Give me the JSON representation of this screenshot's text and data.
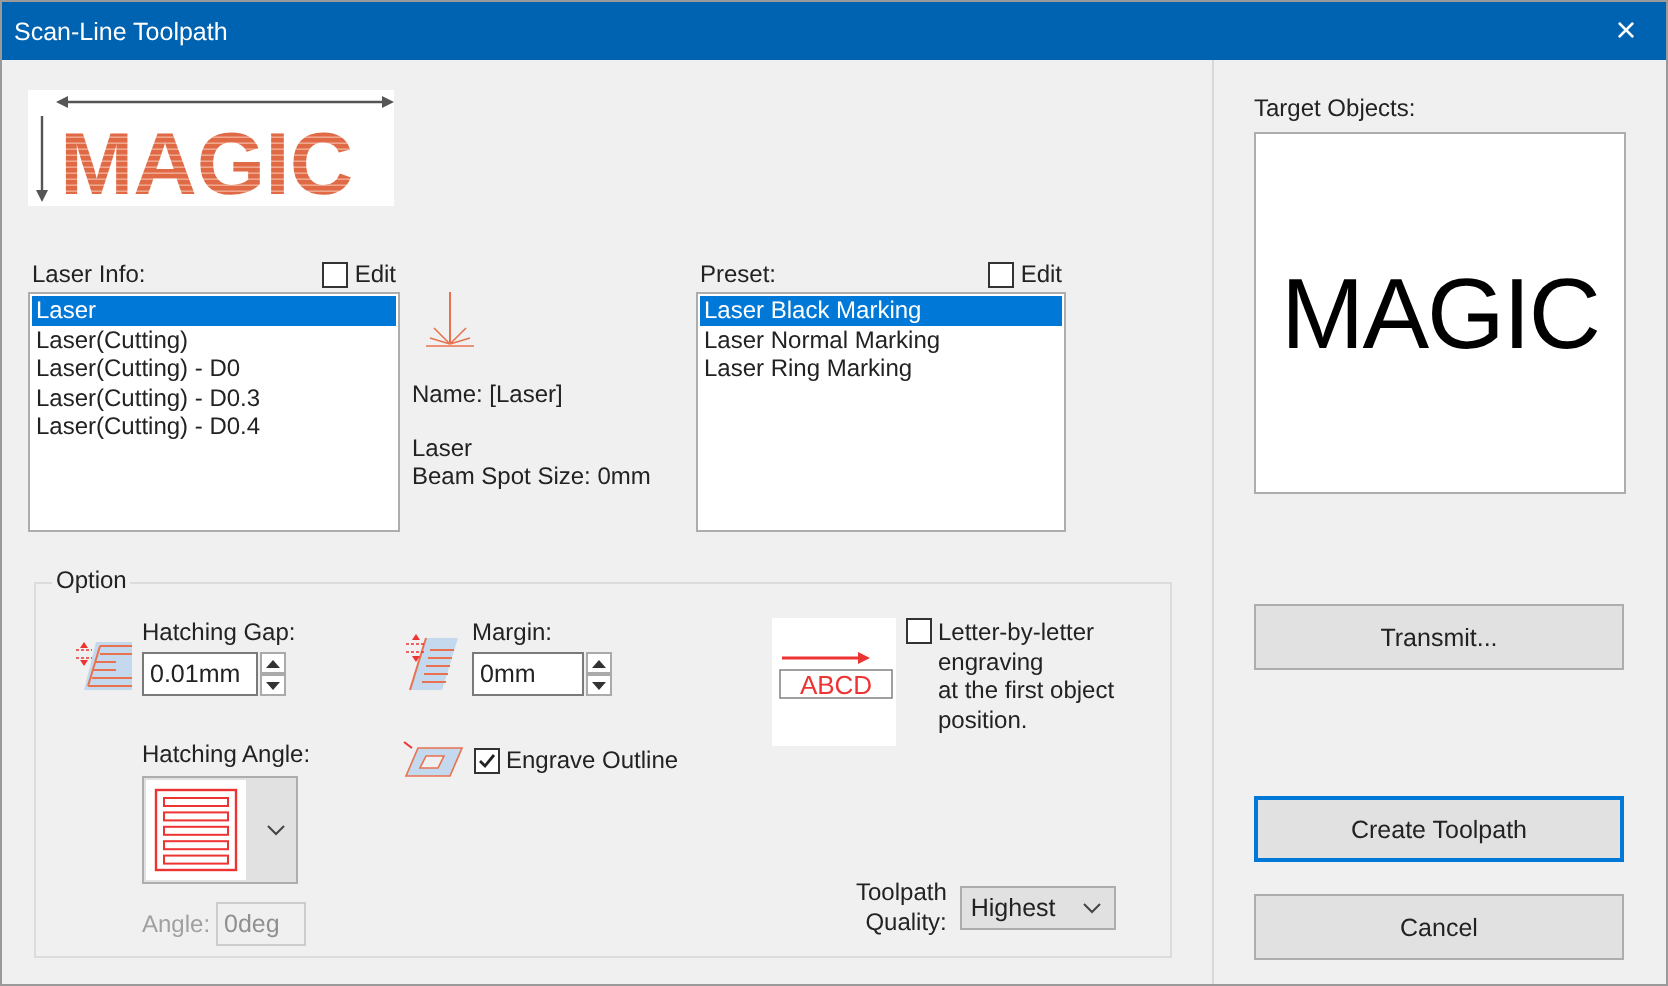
{
  "window": {
    "title": "Scan-Line Toolpath",
    "close": "×"
  },
  "preview": {
    "text": "MAGIC"
  },
  "laser_info": {
    "label": "Laser Info:",
    "edit": {
      "label": "Edit",
      "checked": false
    },
    "items": [
      {
        "label": "Laser",
        "selected": true
      },
      {
        "label": "Laser(Cutting)",
        "selected": false
      },
      {
        "label": "Laser(Cutting) - D0",
        "selected": false
      },
      {
        "label": "Laser(Cutting) - D0.3",
        "selected": false
      },
      {
        "label": "Laser(Cutting) - D0.4",
        "selected": false
      }
    ]
  },
  "laser_details": {
    "name": "Name: [Laser]",
    "type": "Laser",
    "beam_spot": "Beam Spot Size: 0mm"
  },
  "preset": {
    "label": "Preset:",
    "edit": {
      "label": "Edit",
      "checked": false
    },
    "items": [
      {
        "label": "Laser Black Marking",
        "selected": true
      },
      {
        "label": "Laser Normal Marking",
        "selected": false
      },
      {
        "label": "Laser Ring Marking",
        "selected": false
      }
    ]
  },
  "option": {
    "title": "Option",
    "hatching_gap": {
      "label": "Hatching Gap:",
      "value": "0.01mm"
    },
    "margin": {
      "label": "Margin:",
      "value": "0mm"
    },
    "hatching_angle": {
      "label": "Hatching Angle:"
    },
    "angle": {
      "label": "Angle:",
      "value": "0deg",
      "disabled": true
    },
    "engrave_outline": {
      "label": "Engrave Outline",
      "checked": true
    },
    "letter_by_letter": {
      "label": "Letter-by-letter\nengraving\nat the first object\nposition.",
      "checked": false,
      "sample": "ABCD"
    },
    "toolpath_quality": {
      "label": "Toolpath\nQuality:",
      "value": "Highest"
    }
  },
  "target_objects": {
    "label": "Target Objects:",
    "text": "MAGIC"
  },
  "buttons": [
    {
      "label": "Transmit...",
      "focused": false
    },
    {
      "label": "Create Toolpath",
      "focused": true
    },
    {
      "label": "Cancel",
      "focused": false
    }
  ]
}
